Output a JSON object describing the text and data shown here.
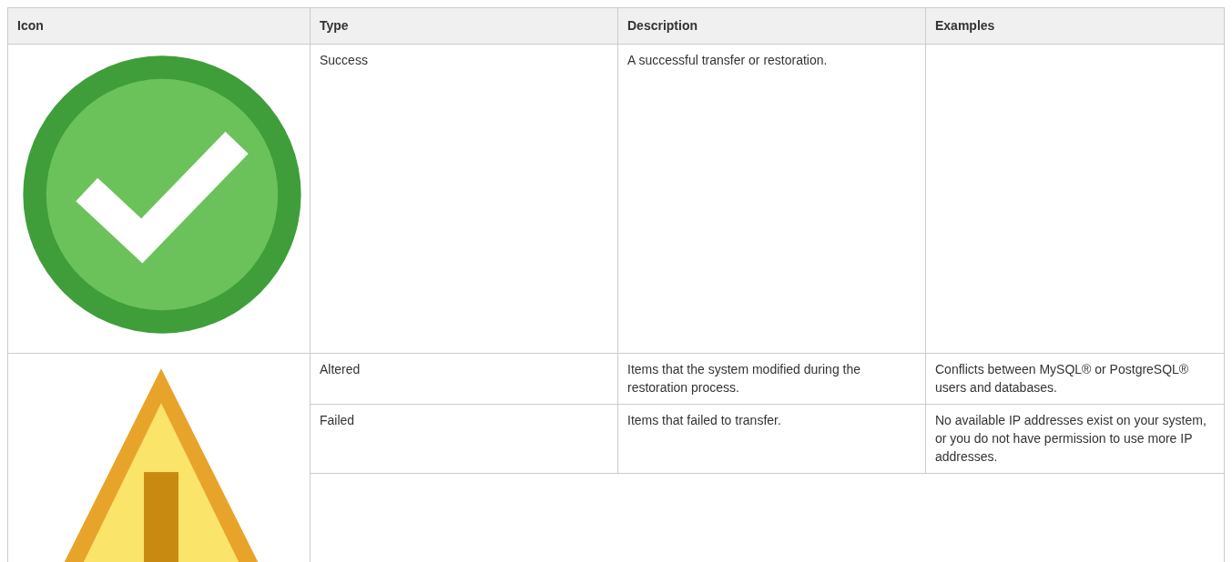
{
  "table": {
    "columns": [
      "Icon",
      "Type",
      "Description",
      "Examples"
    ],
    "groups": [
      {
        "kind": "success",
        "rows": [
          {
            "type": "Success",
            "description": "A successful transfer or restoration."
          }
        ]
      },
      {
        "kind": "warning",
        "rows": [
          {
            "type": "Altered",
            "description": "Items that the system modified during the restoration process.",
            "examples": "Conflicts between MySQL® or PostgreSQL® users and databases."
          },
          {
            "type": "Failed",
            "description": "Items that failed to transfer.",
            "examples": "No available IP addresses exist on your system, or you do not have permission to use more IP addresses."
          }
        ]
      }
    ]
  }
}
